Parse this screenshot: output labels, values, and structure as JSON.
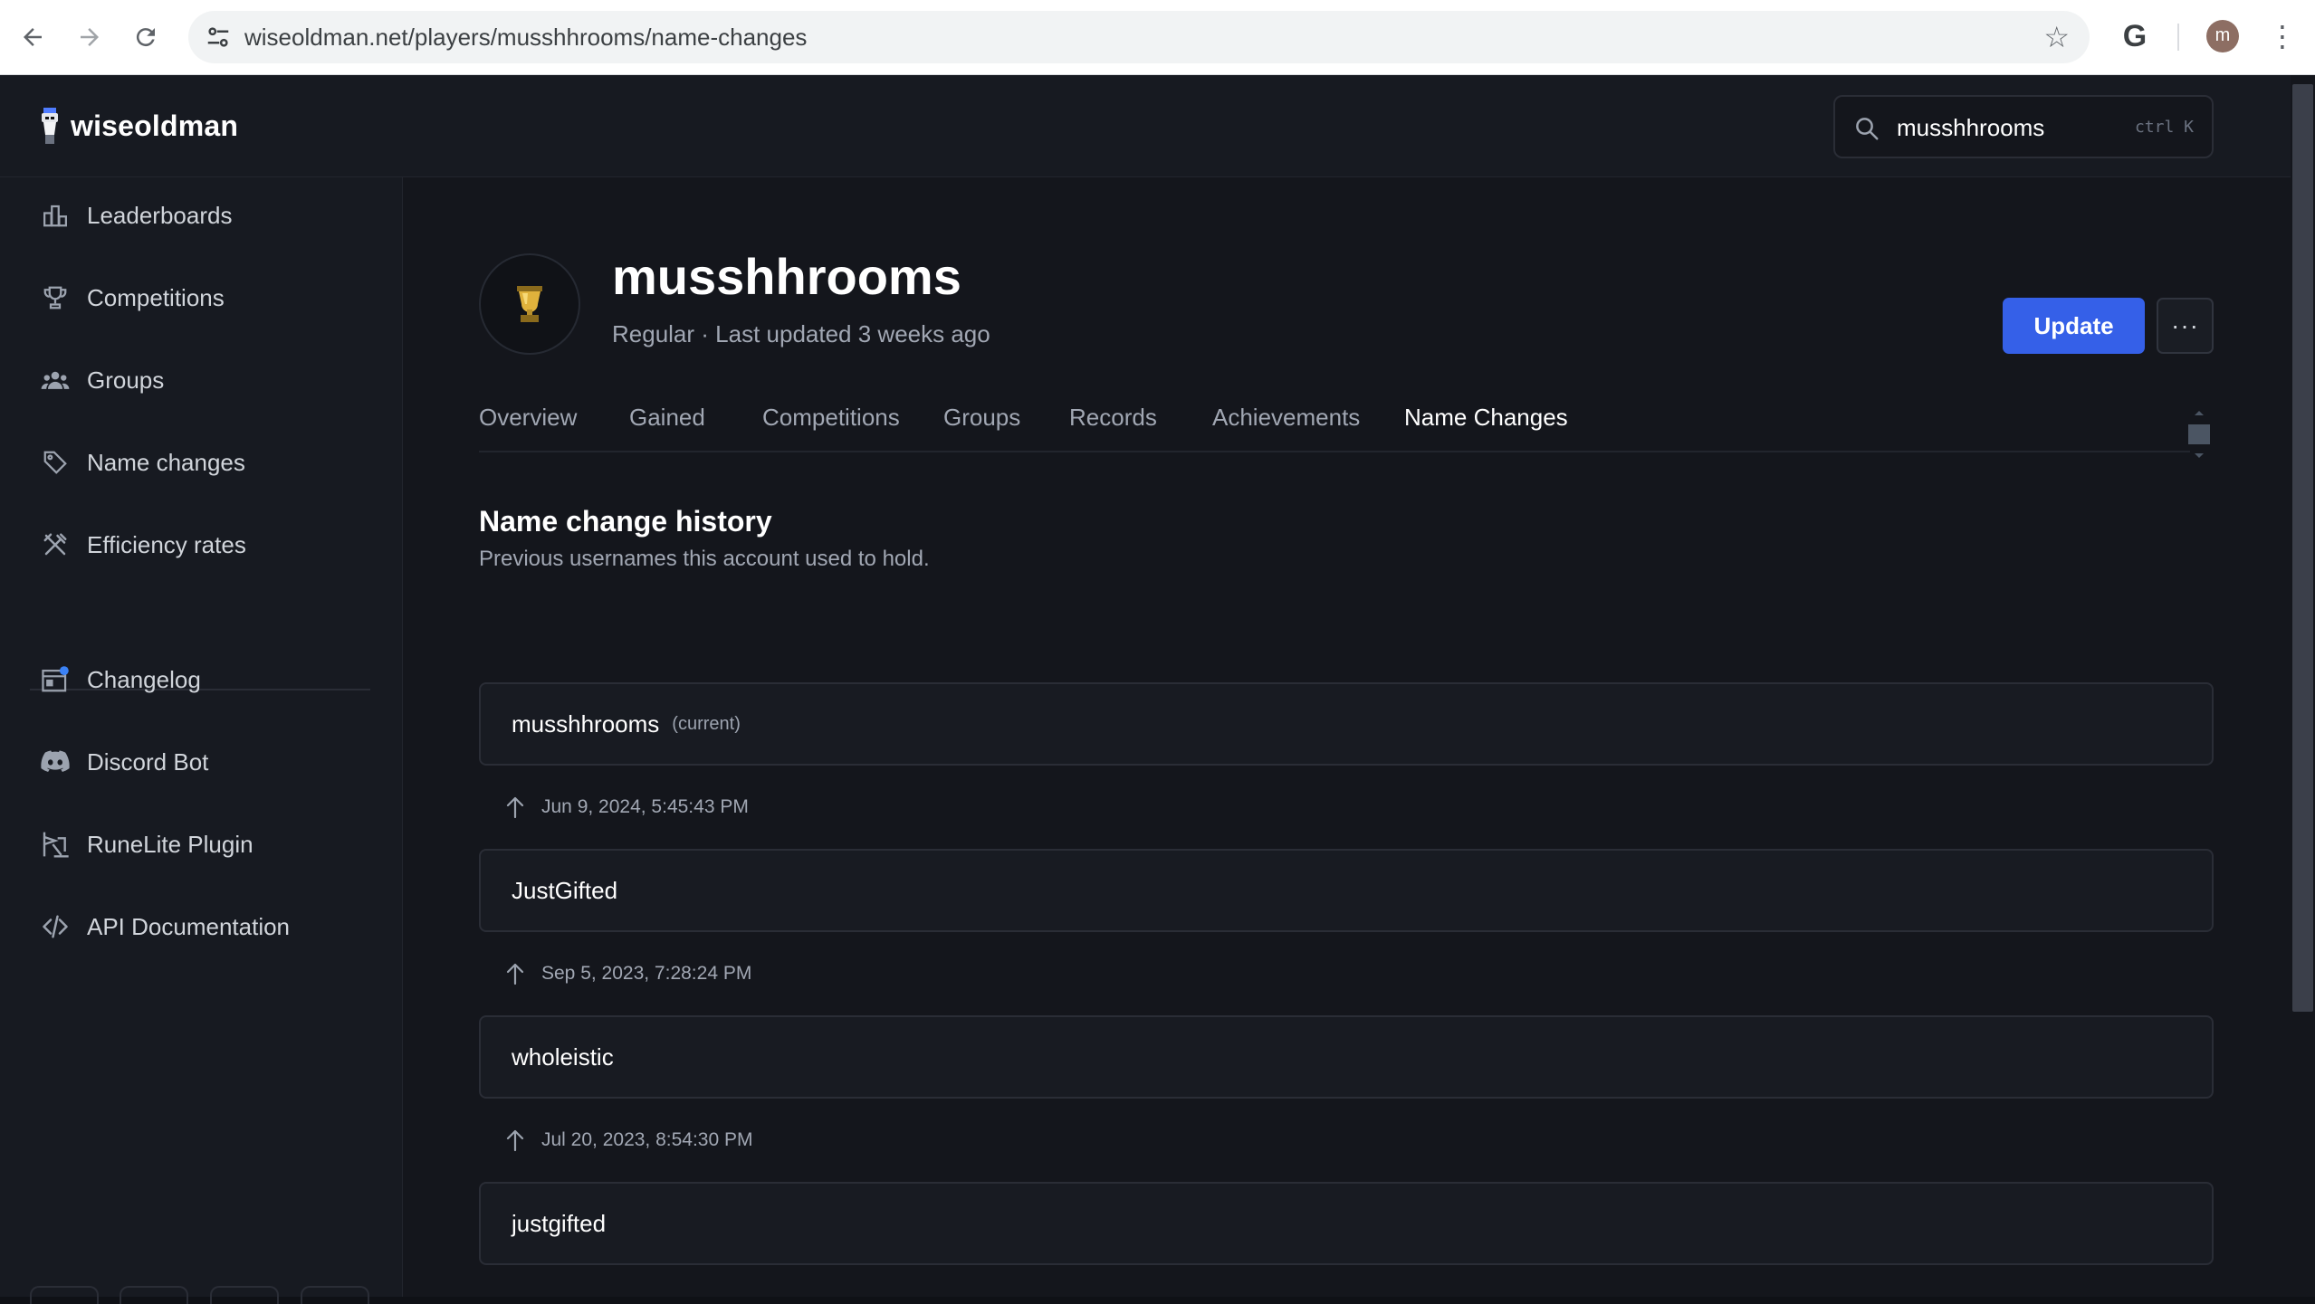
{
  "browser": {
    "url": "wiseoldman.net/players/musshhrooms/name-changes",
    "profile_initial": "m",
    "g_label": "G"
  },
  "brand": {
    "name": "wiseoldman"
  },
  "search": {
    "value": "musshhrooms",
    "shortcut": "ctrl K"
  },
  "sidebar": {
    "items": [
      {
        "label": "Leaderboards",
        "icon": "leaderboard-icon"
      },
      {
        "label": "Competitions",
        "icon": "trophy-icon"
      },
      {
        "label": "Groups",
        "icon": "groups-icon"
      },
      {
        "label": "Name changes",
        "icon": "tag-icon"
      },
      {
        "label": "Efficiency rates",
        "icon": "tools-icon"
      }
    ],
    "secondary": [
      {
        "label": "Changelog",
        "icon": "changelog-icon"
      },
      {
        "label": "Discord Bot",
        "icon": "discord-icon"
      },
      {
        "label": "RuneLite Plugin",
        "icon": "runelite-icon"
      },
      {
        "label": "API Documentation",
        "icon": "code-icon"
      }
    ]
  },
  "player": {
    "name": "musshhrooms",
    "subtitle": "Regular · Last updated 3 weeks ago",
    "update_label": "Update",
    "more_label": "···"
  },
  "tabs": [
    {
      "label": "Overview",
      "active": false
    },
    {
      "label": "Gained",
      "active": false
    },
    {
      "label": "Competitions",
      "active": false
    },
    {
      "label": "Groups",
      "active": false
    },
    {
      "label": "Records",
      "active": false
    },
    {
      "label": "Achievements",
      "active": false
    },
    {
      "label": "Name Changes",
      "active": true
    }
  ],
  "history": {
    "title": "Name change history",
    "subtitle": "Previous usernames this account used to hold.",
    "current_tag": "(current)",
    "names": [
      "musshhrooms",
      "JustGifted",
      "wholeistic",
      "justgifted"
    ],
    "dates": [
      "Jun 9, 2024, 5:45:43 PM",
      "Sep 5, 2023, 7:28:24 PM",
      "Jul 20, 2023, 8:54:30 PM"
    ]
  },
  "colors": {
    "accent": "#3560e8",
    "background": "#14161c",
    "panel": "#171a21"
  }
}
